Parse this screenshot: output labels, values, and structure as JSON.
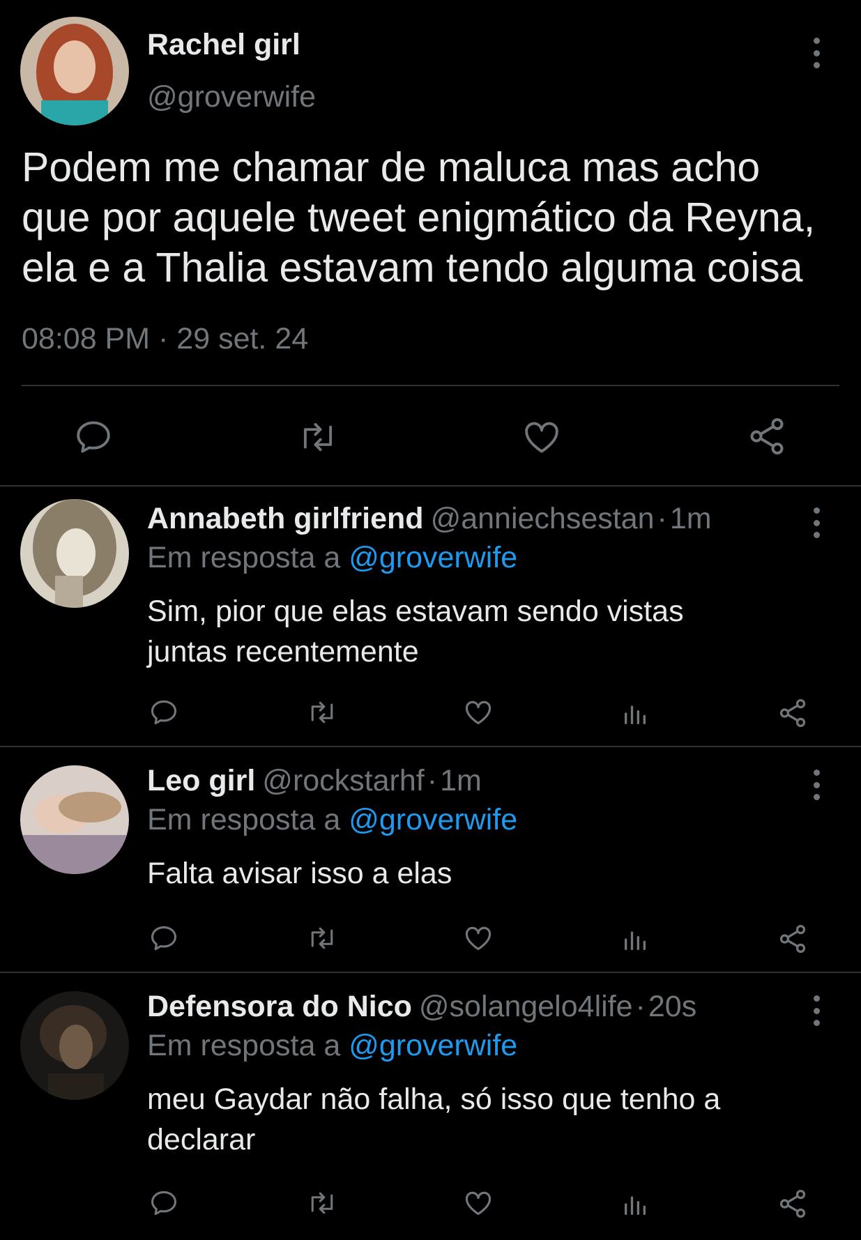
{
  "main_tweet": {
    "name": "Rachel girl",
    "handle": "@groverwife",
    "text_lines": [
      "Podem me chamar de maluca mas acho",
      "que por aquele tweet enigmático da Reyna,",
      "ela e a Thalia estavam tendo alguma coisa"
    ],
    "time": "08:08 PM",
    "date": "29 set. 24",
    "icons": [
      "reply-icon",
      "retweet-icon",
      "like-icon",
      "share-icon"
    ]
  },
  "replies": [
    {
      "name": "Annabeth girlfriend",
      "handle": "@anniechsestan",
      "time": "1m",
      "in_reply_label": "Em resposta a",
      "in_reply_handle": "@groverwife",
      "text_lines": [
        "Sim, pior que elas estavam sendo vistas",
        "juntas recentemente"
      ]
    },
    {
      "name": "Leo girl",
      "handle": "@rockstarhf",
      "time": "1m",
      "in_reply_label": "Em resposta a",
      "in_reply_handle": "@groverwife",
      "text_lines": [
        "Falta avisar isso a elas"
      ]
    },
    {
      "name": "Defensora do Nico",
      "handle": "@solangelo4life",
      "time": "20s",
      "in_reply_label": "Em resposta a",
      "in_reply_handle": "@groverwife",
      "text_lines": [
        "meu Gaydar não falha, só isso que tenho a",
        "declarar"
      ]
    }
  ],
  "separator": "·",
  "colors": {
    "background": "#000000",
    "text": "#e7e9ea",
    "muted": "#71767b",
    "link": "#1d9bf0",
    "divider": "#2f3336"
  }
}
